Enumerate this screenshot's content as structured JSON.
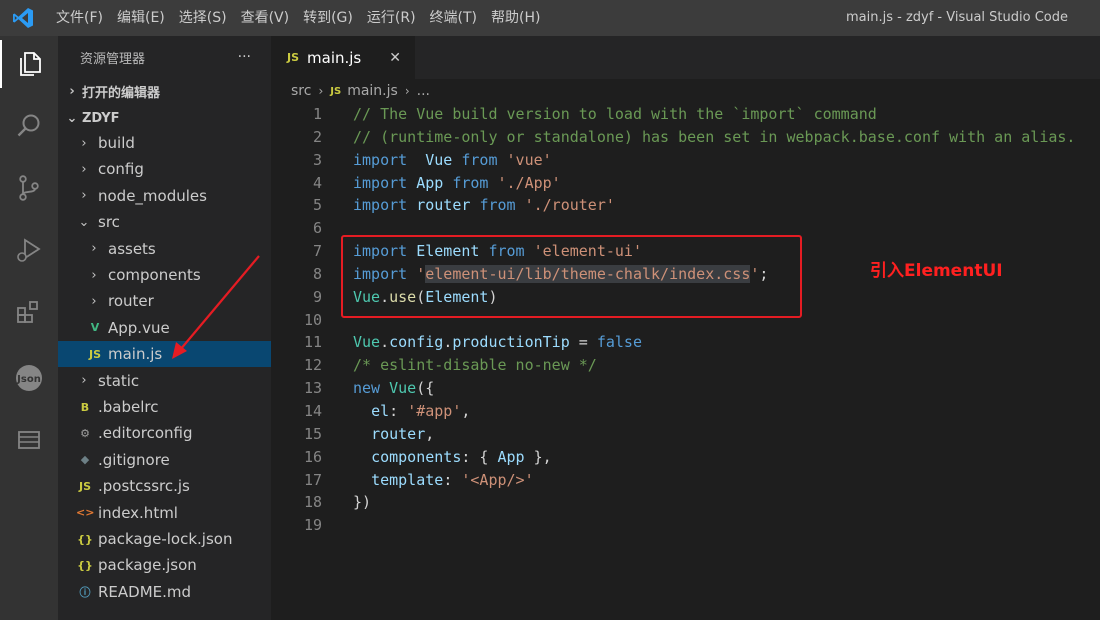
{
  "titlebar": {
    "menus": [
      "文件(F)",
      "编辑(E)",
      "选择(S)",
      "查看(V)",
      "转到(G)",
      "运行(R)",
      "终端(T)",
      "帮助(H)"
    ],
    "window_title": "main.js - zdyf - Visual Studio Code"
  },
  "activity_bar": {
    "items": [
      "explorer-icon",
      "search-icon",
      "source-control-icon",
      "run-debug-icon",
      "extensions-icon",
      "json-icon",
      "remote-explorer-icon"
    ]
  },
  "sidebar": {
    "title": "资源管理器",
    "more": "···",
    "open_editors": "打开的编辑器",
    "project": "ZDYF",
    "tree": [
      {
        "label": "build",
        "type": "folder",
        "depth": 1,
        "open": false
      },
      {
        "label": "config",
        "type": "folder",
        "depth": 1,
        "open": false
      },
      {
        "label": "node_modules",
        "type": "folder",
        "depth": 1,
        "open": false
      },
      {
        "label": "src",
        "type": "folder",
        "depth": 1,
        "open": true
      },
      {
        "label": "assets",
        "type": "folder",
        "depth": 2,
        "open": false
      },
      {
        "label": "components",
        "type": "folder",
        "depth": 2,
        "open": false
      },
      {
        "label": "router",
        "type": "folder",
        "depth": 2,
        "open": false
      },
      {
        "label": "App.vue",
        "type": "vue",
        "depth": 2
      },
      {
        "label": "main.js",
        "type": "js",
        "depth": 2,
        "selected": true
      },
      {
        "label": "static",
        "type": "folder",
        "depth": 1,
        "open": false
      },
      {
        "label": ".babelrc",
        "type": "babel",
        "depth": 1
      },
      {
        "label": ".editorconfig",
        "type": "gear",
        "depth": 1
      },
      {
        "label": ".gitignore",
        "type": "git",
        "depth": 1
      },
      {
        "label": ".postcssrc.js",
        "type": "js",
        "depth": 1
      },
      {
        "label": "index.html",
        "type": "html",
        "depth": 1
      },
      {
        "label": "package-lock.json",
        "type": "json",
        "depth": 1
      },
      {
        "label": "package.json",
        "type": "json",
        "depth": 1
      },
      {
        "label": "README.md",
        "type": "info",
        "depth": 1
      }
    ],
    "icon_glyphs": {
      "folder": "",
      "vue": "V",
      "js": "JS",
      "babel": "B",
      "gear": "⚙",
      "git": "◆",
      "html": "<>",
      "json": "{}",
      "info": "ⓘ"
    },
    "icon_colors": {
      "vue": "#41b883",
      "js": "#cbcb41",
      "babel": "#cbcb41",
      "gear": "#a0a0a0",
      "git": "#6d8086",
      "html": "#e37933",
      "json": "#cbcb41",
      "info": "#519aba"
    }
  },
  "editor": {
    "tab_label": "main.js",
    "tab_icon": "JS",
    "close": "✕",
    "breadcrumb": [
      "src",
      "main.js",
      "..."
    ],
    "annotation": "引入ElementUI",
    "annotation_color": "#e51c23"
  },
  "code_lines": [
    [
      [
        "cm",
        "// The Vue build version to load with the `import` command"
      ]
    ],
    [
      [
        "cm",
        "// (runtime-only or standalone) has been set in webpack.base.conf with an alias."
      ]
    ],
    [
      [
        "kw2",
        "import"
      ],
      [
        "",
        "  "
      ],
      [
        "var",
        "Vue"
      ],
      [
        "",
        " "
      ],
      [
        "kw2",
        "from"
      ],
      [
        "",
        " "
      ],
      [
        "str",
        "'vue'"
      ]
    ],
    [
      [
        "kw2",
        "import"
      ],
      [
        "",
        " "
      ],
      [
        "var",
        "App"
      ],
      [
        "",
        " "
      ],
      [
        "kw2",
        "from"
      ],
      [
        "",
        " "
      ],
      [
        "str",
        "'./App'"
      ]
    ],
    [
      [
        "kw2",
        "import"
      ],
      [
        "",
        " "
      ],
      [
        "var",
        "router"
      ],
      [
        "",
        " "
      ],
      [
        "kw2",
        "from"
      ],
      [
        "",
        " "
      ],
      [
        "str",
        "'./router'"
      ]
    ],
    [],
    [
      [
        "kw2",
        "import"
      ],
      [
        "",
        " "
      ],
      [
        "var",
        "Element"
      ],
      [
        "",
        " "
      ],
      [
        "kw2",
        "from"
      ],
      [
        "",
        " "
      ],
      [
        "str",
        "'element-ui'"
      ]
    ],
    [
      [
        "kw2",
        "import"
      ],
      [
        "",
        " "
      ],
      [
        "str",
        "'"
      ],
      [
        "strhl",
        "element-ui/lib/theme-chalk/index.css"
      ],
      [
        "str",
        "'"
      ],
      [
        "",
        ";"
      ]
    ],
    [
      [
        "cls",
        "Vue"
      ],
      [
        "",
        "."
      ],
      [
        "fn",
        "use"
      ],
      [
        "",
        "("
      ],
      [
        "var",
        "Element"
      ],
      [
        "",
        ")"
      ]
    ],
    [],
    [
      [
        "cls",
        "Vue"
      ],
      [
        "",
        "."
      ],
      [
        "var",
        "config"
      ],
      [
        "",
        "."
      ],
      [
        "var",
        "productionTip"
      ],
      [
        "",
        " = "
      ],
      [
        "kw",
        "false"
      ]
    ],
    [
      [
        "cm",
        "/* eslint-disable no-new */"
      ]
    ],
    [
      [
        "kw",
        "new"
      ],
      [
        "",
        " "
      ],
      [
        "cls",
        "Vue"
      ],
      [
        "",
        "({"
      ]
    ],
    [
      [
        "",
        "  "
      ],
      [
        "var",
        "el"
      ],
      [
        "",
        ": "
      ],
      [
        "str",
        "'#app'"
      ],
      [
        "",
        ","
      ]
    ],
    [
      [
        "",
        "  "
      ],
      [
        "var",
        "router"
      ],
      [
        "",
        ","
      ]
    ],
    [
      [
        "",
        "  "
      ],
      [
        "var",
        "components"
      ],
      [
        "",
        ": { "
      ],
      [
        "var",
        "App"
      ],
      [
        "",
        " },"
      ]
    ],
    [
      [
        "",
        "  "
      ],
      [
        "var",
        "template"
      ],
      [
        "",
        ": "
      ],
      [
        "str",
        "'<App/>'"
      ]
    ],
    [
      [
        "",
        "})"
      ]
    ],
    []
  ]
}
